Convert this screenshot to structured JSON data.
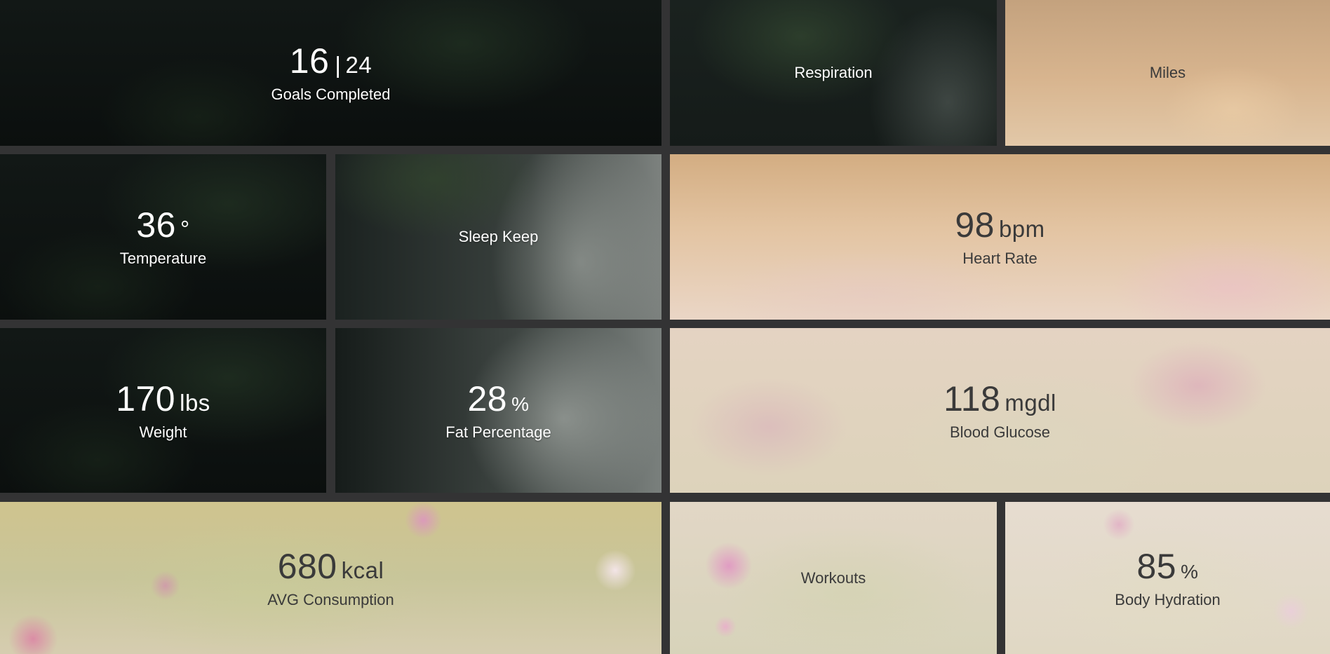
{
  "tiles": {
    "goals": {
      "value": "16",
      "separator": "|",
      "total": "24",
      "label": "Goals Completed"
    },
    "respiration": {
      "label": "Respiration"
    },
    "miles": {
      "label": "Miles"
    },
    "temperature": {
      "value": "36",
      "unit": "°",
      "label": "Temperature"
    },
    "sleep": {
      "label": "Sleep Keep"
    },
    "heart_rate": {
      "value": "98",
      "unit": "bpm",
      "label": "Heart Rate"
    },
    "weight": {
      "value": "170",
      "unit": "lbs",
      "label": "Weight"
    },
    "fat": {
      "value": "28",
      "unit": "%",
      "label": "Fat Percentage"
    },
    "glucose": {
      "value": "118",
      "unit": "mgdl",
      "label": "Blood Glucose"
    },
    "consumption": {
      "value": "680",
      "unit": "kcal",
      "label": "AVG Consumption"
    },
    "workouts": {
      "label": "Workouts"
    },
    "hydration": {
      "value": "85",
      "unit": "%",
      "label": "Body Hydration"
    }
  },
  "colors": {
    "gutter": "#333334",
    "dark_text": "#ffffff",
    "light_text": "#3a3a3a"
  }
}
